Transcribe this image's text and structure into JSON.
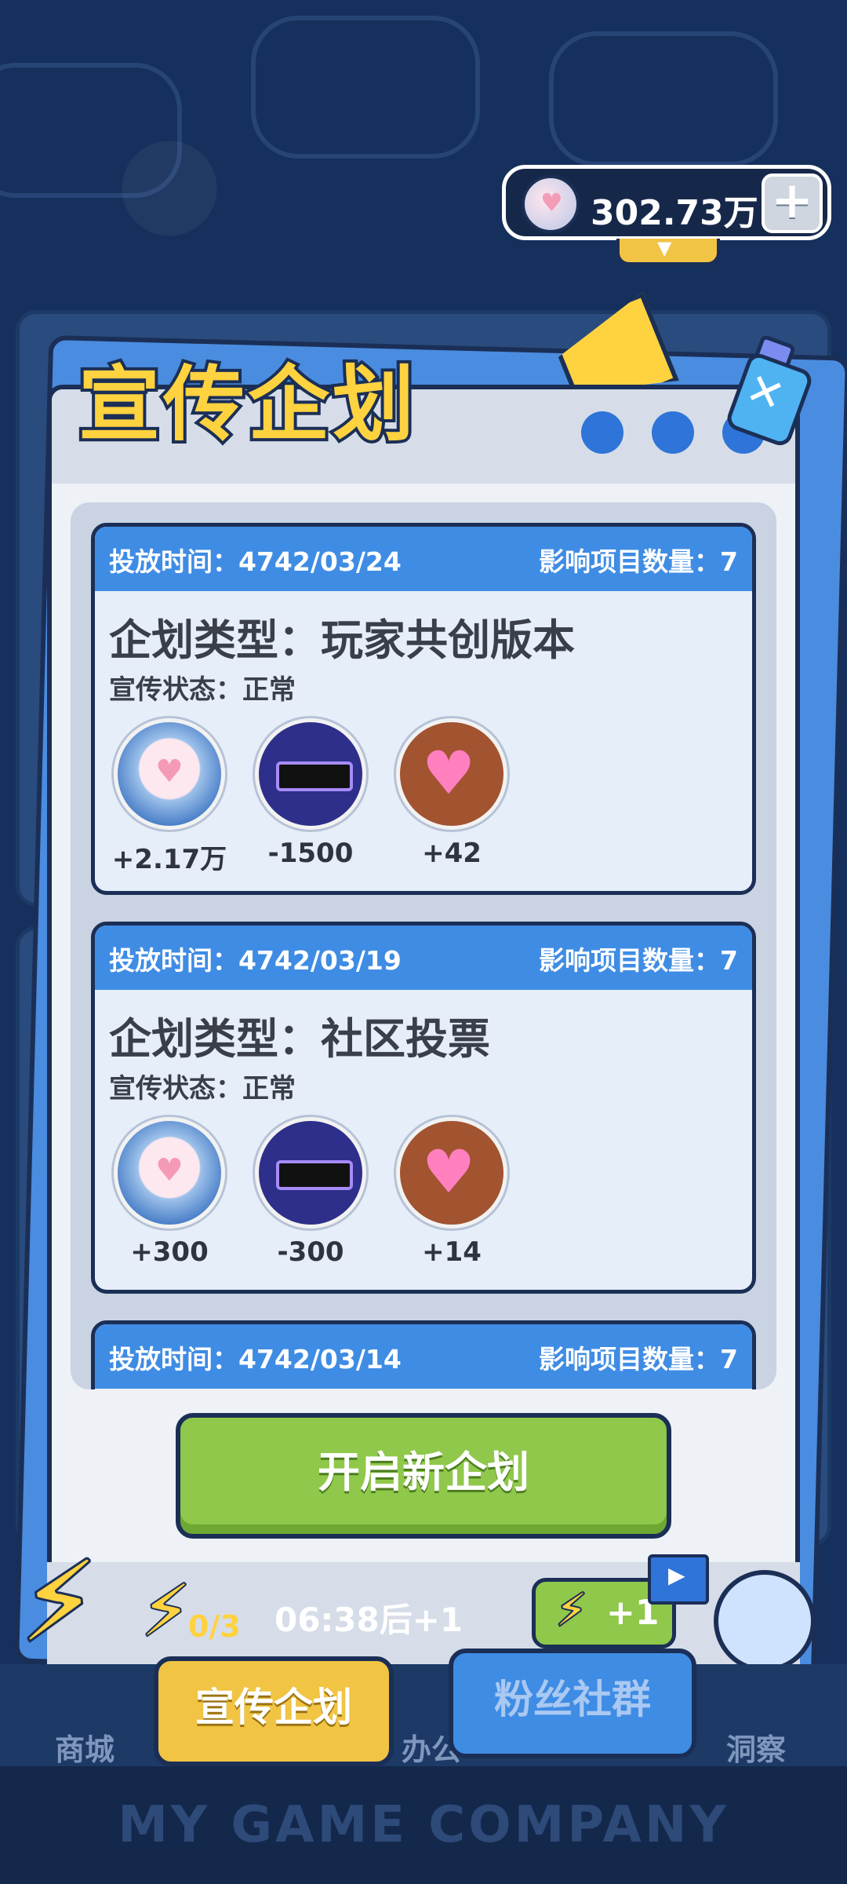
{
  "currency": {
    "amount": "302.73万",
    "plus_label": "+"
  },
  "window": {
    "title": "宣传企划"
  },
  "campaigns": [
    {
      "time": "投放时间：4742/03/24",
      "count": "影响项目数量：7",
      "type": "企划类型：玩家共创版本",
      "status": "宣传状态：正常",
      "effects": [
        {
          "icon": "fans-icon",
          "value": "+2.17万"
        },
        {
          "icon": "pixel-sunglasses-icon",
          "value": "-1500"
        },
        {
          "icon": "heart-icon",
          "value": "+42"
        }
      ]
    },
    {
      "time": "投放时间：4742/03/19",
      "count": "影响项目数量：7",
      "type": "企划类型：社区投票",
      "status": "宣传状态：正常",
      "effects": [
        {
          "icon": "fans-icon",
          "value": "+300"
        },
        {
          "icon": "pixel-sunglasses-icon",
          "value": "-300"
        },
        {
          "icon": "heart-icon",
          "value": "+14"
        }
      ]
    },
    {
      "time": "投放时间：4742/03/14",
      "count": "影响项目数量：7"
    }
  ],
  "start_button": "开启新企划",
  "energy": {
    "count": "0/3",
    "timer": "06:38后+1",
    "ad_label": "+1"
  },
  "nav": {
    "shop": "商城",
    "promo": "宣传企划",
    "office": "办公",
    "fans": "粉丝社群",
    "insight": "洞察"
  },
  "footer_brand": "MY GAME COMPANY"
}
